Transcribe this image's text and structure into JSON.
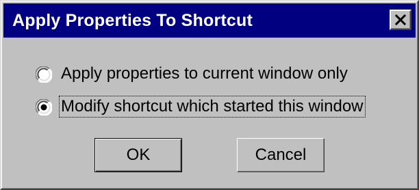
{
  "window": {
    "title": "Apply Properties To Shortcut",
    "close_icon": "close-x-icon"
  },
  "options": [
    {
      "label": "Apply properties to current window only",
      "checked": false
    },
    {
      "label": "Modify shortcut which started this window",
      "checked": true
    }
  ],
  "buttons": {
    "ok_label": "OK",
    "cancel_label": "Cancel"
  },
  "colors": {
    "titlebar": "#000080",
    "face": "#c0c0c0",
    "title_text": "#ffffff"
  }
}
